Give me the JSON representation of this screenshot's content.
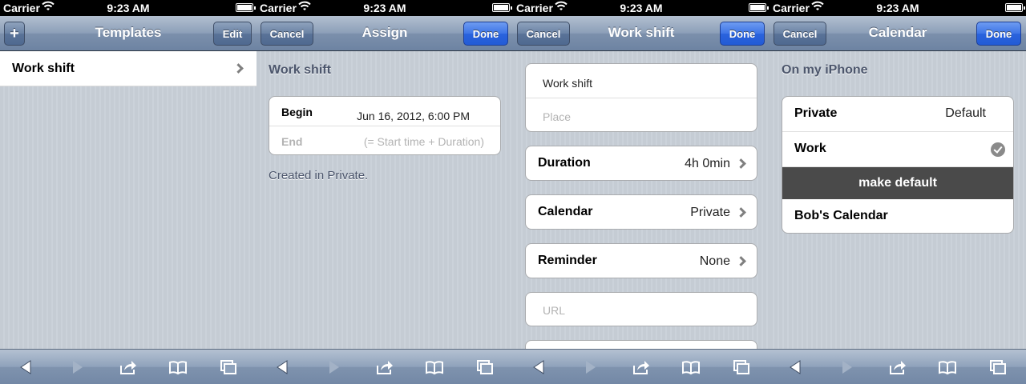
{
  "status": {
    "carrier": "Carrier",
    "time": "9:23 AM"
  },
  "screen1": {
    "nav": {
      "add_label": "+",
      "title": "Templates",
      "edit_label": "Edit"
    },
    "rows": [
      {
        "label": "Work shift"
      }
    ]
  },
  "screen2": {
    "nav": {
      "cancel_label": "Cancel",
      "title": "Assign",
      "done_label": "Done"
    },
    "section_title": "Work shift",
    "begin_label": "Begin",
    "begin_value": "Jun 16, 2012, 6:00 PM",
    "end_label": "End",
    "end_placeholder": "(= Start time + Duration)",
    "footnote": "Created in Private."
  },
  "screen3": {
    "nav": {
      "cancel_label": "Cancel",
      "title": "Work shift",
      "done_label": "Done"
    },
    "title_field": "Work shift",
    "place_placeholder": "Place",
    "duration_label": "Duration",
    "duration_value": "4h 0min",
    "calendar_label": "Calendar",
    "calendar_value": "Private",
    "reminder_label": "Reminder",
    "reminder_value": "None",
    "url_placeholder": "URL"
  },
  "screen4": {
    "nav": {
      "cancel_label": "Cancel",
      "title": "Calendar",
      "done_label": "Done"
    },
    "section_title": "On my iPhone",
    "calendars": [
      {
        "name": "Private",
        "value": "Default"
      },
      {
        "name": "Work",
        "value": ""
      },
      {
        "name": "Bob's Calendar",
        "value": ""
      }
    ],
    "make_default_label": "make default"
  },
  "toolbar": {
    "icons": [
      "back-arrow-icon",
      "forward-arrow-icon",
      "share-icon",
      "bookmarks-icon",
      "tabs-icon"
    ]
  }
}
